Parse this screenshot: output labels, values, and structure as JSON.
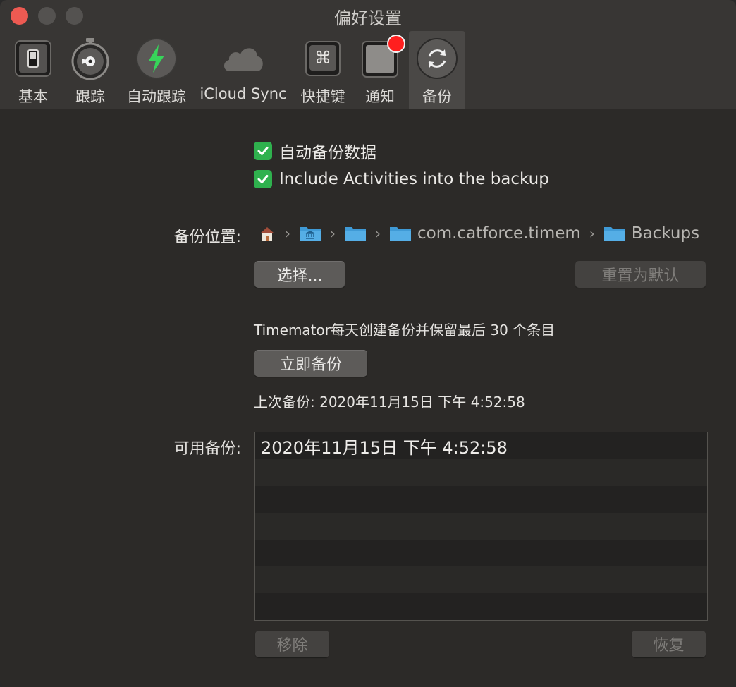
{
  "window": {
    "title": "偏好设置"
  },
  "toolbar": {
    "items": [
      {
        "label": "基本",
        "icon": "switch-icon"
      },
      {
        "label": "跟踪",
        "icon": "stopwatch-icon"
      },
      {
        "label": "自动跟踪",
        "icon": "bolt-icon"
      },
      {
        "label": "iCloud Sync",
        "icon": "cloud-icon"
      },
      {
        "label": "快捷键",
        "icon": "command-key-icon"
      },
      {
        "label": "通知",
        "icon": "notification-icon"
      },
      {
        "label": "备份",
        "icon": "sync-icon"
      }
    ],
    "selected": "备份"
  },
  "options": {
    "auto_backup": {
      "label": "自动备份数据",
      "checked": true
    },
    "include_activities": {
      "label": "Include Activities into the backup",
      "checked": true
    }
  },
  "location": {
    "label": "备份位置:",
    "path_segments": [
      "com.catforce.timem",
      "Backups"
    ],
    "choose_button": "选择...",
    "reset_button": "重置为默认"
  },
  "schedule_info": "Timemator每天创建备份并保留最后 30 个条目",
  "backup_now_button": "立即备份",
  "last_backup": "上次备份: 2020年11月15日 下午 4:52:58",
  "available": {
    "label": "可用备份:",
    "items": [
      "2020年11月15日 下午 4:52:58",
      "",
      "",
      "",
      "",
      "",
      ""
    ],
    "remove_button": "移除",
    "restore_button": "恢复"
  },
  "colors": {
    "accent_check": "#2fb14e",
    "close_button": "#ed5a52",
    "notification_badge": "#ff1f1f",
    "folder_blue": "#3f9ad6"
  }
}
